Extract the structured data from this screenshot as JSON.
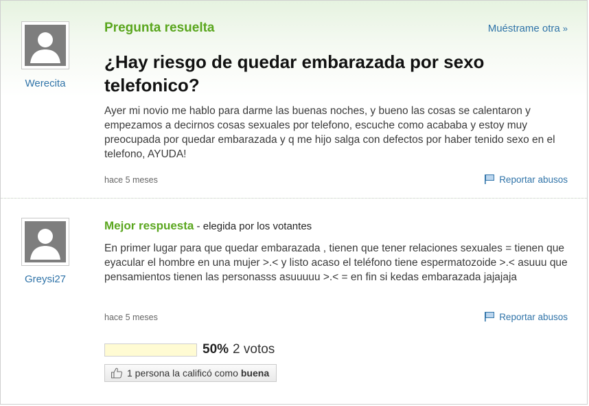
{
  "question": {
    "status": "Pregunta resuelta",
    "show_another": "Muéstrame otra",
    "show_another_arrow": "»",
    "title": "¿Hay riesgo de quedar embarazada por sexo telefonico?",
    "body": "Ayer mi novio me hablo para darme las buenas noches, y bueno las cosas se calentaron y empezamos a decirnos cosas sexuales por telefono, escuche como acababa y estoy muy preocupada por quedar embarazada y q me hijo salga con defectos por haber tenido sexo en el telefono, AYUDA!",
    "time": "hace 5 meses",
    "report": "Reportar abusos",
    "user": "Werecita"
  },
  "answer": {
    "label": "Mejor respuesta",
    "label_suffix": " - elegida por los votantes",
    "body": "En primer lugar para que quedar embarazada , tienen que tener relaciones sexuales = tienen que eyacular el hombre en una mujer >.< y listo acaso el teléfono tiene espermatozoide >.< asuuu que pensamientos tienen las personasss asuuuuu >.< = en fin si kedas embarazada jajajaja",
    "time": "hace 5 meses",
    "report": "Reportar abusos",
    "user": "Greysi27"
  },
  "votes": {
    "percent": "50%",
    "percent_value": 0.5,
    "count": "2 votos"
  },
  "rating": {
    "text": "1 persona la calificó como",
    "word": "buena"
  },
  "colors": {
    "link": "#2f73a8",
    "green": "#5aa61e",
    "vote_bar": "#fffbd3"
  },
  "icons": [
    "user-avatar-icon",
    "flag-icon",
    "thumbs-up-icon"
  ]
}
